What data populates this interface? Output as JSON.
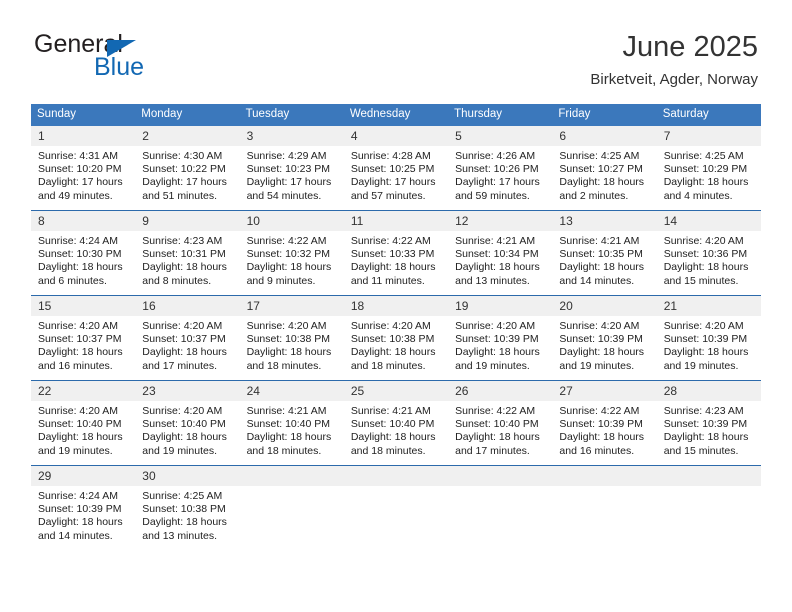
{
  "brand": {
    "name_part1": "General",
    "name_part2": "Blue",
    "triangle_icon": "triangle-icon",
    "accent_color": "#1268b3"
  },
  "header": {
    "title": "June 2025",
    "subtitle": "Birketveit, Agder, Norway"
  },
  "theme": {
    "header_blue": "#3b78bc",
    "separator_blue": "#2c6aab",
    "daynum_band": "#f0f0f0",
    "text": "#222222"
  },
  "calendar": {
    "weekday_headers": [
      "Sunday",
      "Monday",
      "Tuesday",
      "Wednesday",
      "Thursday",
      "Friday",
      "Saturday"
    ],
    "weeks": [
      [
        {
          "day": "1",
          "sunrise": "Sunrise: 4:31 AM",
          "sunset": "Sunset: 10:20 PM",
          "daylight_line1": "Daylight: 17 hours",
          "daylight_line2": "and 49 minutes."
        },
        {
          "day": "2",
          "sunrise": "Sunrise: 4:30 AM",
          "sunset": "Sunset: 10:22 PM",
          "daylight_line1": "Daylight: 17 hours",
          "daylight_line2": "and 51 minutes."
        },
        {
          "day": "3",
          "sunrise": "Sunrise: 4:29 AM",
          "sunset": "Sunset: 10:23 PM",
          "daylight_line1": "Daylight: 17 hours",
          "daylight_line2": "and 54 minutes."
        },
        {
          "day": "4",
          "sunrise": "Sunrise: 4:28 AM",
          "sunset": "Sunset: 10:25 PM",
          "daylight_line1": "Daylight: 17 hours",
          "daylight_line2": "and 57 minutes."
        },
        {
          "day": "5",
          "sunrise": "Sunrise: 4:26 AM",
          "sunset": "Sunset: 10:26 PM",
          "daylight_line1": "Daylight: 17 hours",
          "daylight_line2": "and 59 minutes."
        },
        {
          "day": "6",
          "sunrise": "Sunrise: 4:25 AM",
          "sunset": "Sunset: 10:27 PM",
          "daylight_line1": "Daylight: 18 hours",
          "daylight_line2": "and 2 minutes."
        },
        {
          "day": "7",
          "sunrise": "Sunrise: 4:25 AM",
          "sunset": "Sunset: 10:29 PM",
          "daylight_line1": "Daylight: 18 hours",
          "daylight_line2": "and 4 minutes."
        }
      ],
      [
        {
          "day": "8",
          "sunrise": "Sunrise: 4:24 AM",
          "sunset": "Sunset: 10:30 PM",
          "daylight_line1": "Daylight: 18 hours",
          "daylight_line2": "and 6 minutes."
        },
        {
          "day": "9",
          "sunrise": "Sunrise: 4:23 AM",
          "sunset": "Sunset: 10:31 PM",
          "daylight_line1": "Daylight: 18 hours",
          "daylight_line2": "and 8 minutes."
        },
        {
          "day": "10",
          "sunrise": "Sunrise: 4:22 AM",
          "sunset": "Sunset: 10:32 PM",
          "daylight_line1": "Daylight: 18 hours",
          "daylight_line2": "and 9 minutes."
        },
        {
          "day": "11",
          "sunrise": "Sunrise: 4:22 AM",
          "sunset": "Sunset: 10:33 PM",
          "daylight_line1": "Daylight: 18 hours",
          "daylight_line2": "and 11 minutes."
        },
        {
          "day": "12",
          "sunrise": "Sunrise: 4:21 AM",
          "sunset": "Sunset: 10:34 PM",
          "daylight_line1": "Daylight: 18 hours",
          "daylight_line2": "and 13 minutes."
        },
        {
          "day": "13",
          "sunrise": "Sunrise: 4:21 AM",
          "sunset": "Sunset: 10:35 PM",
          "daylight_line1": "Daylight: 18 hours",
          "daylight_line2": "and 14 minutes."
        },
        {
          "day": "14",
          "sunrise": "Sunrise: 4:20 AM",
          "sunset": "Sunset: 10:36 PM",
          "daylight_line1": "Daylight: 18 hours",
          "daylight_line2": "and 15 minutes."
        }
      ],
      [
        {
          "day": "15",
          "sunrise": "Sunrise: 4:20 AM",
          "sunset": "Sunset: 10:37 PM",
          "daylight_line1": "Daylight: 18 hours",
          "daylight_line2": "and 16 minutes."
        },
        {
          "day": "16",
          "sunrise": "Sunrise: 4:20 AM",
          "sunset": "Sunset: 10:37 PM",
          "daylight_line1": "Daylight: 18 hours",
          "daylight_line2": "and 17 minutes."
        },
        {
          "day": "17",
          "sunrise": "Sunrise: 4:20 AM",
          "sunset": "Sunset: 10:38 PM",
          "daylight_line1": "Daylight: 18 hours",
          "daylight_line2": "and 18 minutes."
        },
        {
          "day": "18",
          "sunrise": "Sunrise: 4:20 AM",
          "sunset": "Sunset: 10:38 PM",
          "daylight_line1": "Daylight: 18 hours",
          "daylight_line2": "and 18 minutes."
        },
        {
          "day": "19",
          "sunrise": "Sunrise: 4:20 AM",
          "sunset": "Sunset: 10:39 PM",
          "daylight_line1": "Daylight: 18 hours",
          "daylight_line2": "and 19 minutes."
        },
        {
          "day": "20",
          "sunrise": "Sunrise: 4:20 AM",
          "sunset": "Sunset: 10:39 PM",
          "daylight_line1": "Daylight: 18 hours",
          "daylight_line2": "and 19 minutes."
        },
        {
          "day": "21",
          "sunrise": "Sunrise: 4:20 AM",
          "sunset": "Sunset: 10:39 PM",
          "daylight_line1": "Daylight: 18 hours",
          "daylight_line2": "and 19 minutes."
        }
      ],
      [
        {
          "day": "22",
          "sunrise": "Sunrise: 4:20 AM",
          "sunset": "Sunset: 10:40 PM",
          "daylight_line1": "Daylight: 18 hours",
          "daylight_line2": "and 19 minutes."
        },
        {
          "day": "23",
          "sunrise": "Sunrise: 4:20 AM",
          "sunset": "Sunset: 10:40 PM",
          "daylight_line1": "Daylight: 18 hours",
          "daylight_line2": "and 19 minutes."
        },
        {
          "day": "24",
          "sunrise": "Sunrise: 4:21 AM",
          "sunset": "Sunset: 10:40 PM",
          "daylight_line1": "Daylight: 18 hours",
          "daylight_line2": "and 18 minutes."
        },
        {
          "day": "25",
          "sunrise": "Sunrise: 4:21 AM",
          "sunset": "Sunset: 10:40 PM",
          "daylight_line1": "Daylight: 18 hours",
          "daylight_line2": "and 18 minutes."
        },
        {
          "day": "26",
          "sunrise": "Sunrise: 4:22 AM",
          "sunset": "Sunset: 10:40 PM",
          "daylight_line1": "Daylight: 18 hours",
          "daylight_line2": "and 17 minutes."
        },
        {
          "day": "27",
          "sunrise": "Sunrise: 4:22 AM",
          "sunset": "Sunset: 10:39 PM",
          "daylight_line1": "Daylight: 18 hours",
          "daylight_line2": "and 16 minutes."
        },
        {
          "day": "28",
          "sunrise": "Sunrise: 4:23 AM",
          "sunset": "Sunset: 10:39 PM",
          "daylight_line1": "Daylight: 18 hours",
          "daylight_line2": "and 15 minutes."
        }
      ],
      [
        {
          "day": "29",
          "sunrise": "Sunrise: 4:24 AM",
          "sunset": "Sunset: 10:39 PM",
          "daylight_line1": "Daylight: 18 hours",
          "daylight_line2": "and 14 minutes."
        },
        {
          "day": "30",
          "sunrise": "Sunrise: 4:25 AM",
          "sunset": "Sunset: 10:38 PM",
          "daylight_line1": "Daylight: 18 hours",
          "daylight_line2": "and 13 minutes."
        },
        {
          "day": "",
          "sunrise": "",
          "sunset": "",
          "daylight_line1": "",
          "daylight_line2": ""
        },
        {
          "day": "",
          "sunrise": "",
          "sunset": "",
          "daylight_line1": "",
          "daylight_line2": ""
        },
        {
          "day": "",
          "sunrise": "",
          "sunset": "",
          "daylight_line1": "",
          "daylight_line2": ""
        },
        {
          "day": "",
          "sunrise": "",
          "sunset": "",
          "daylight_line1": "",
          "daylight_line2": ""
        },
        {
          "day": "",
          "sunrise": "",
          "sunset": "",
          "daylight_line1": "",
          "daylight_line2": ""
        }
      ]
    ]
  }
}
